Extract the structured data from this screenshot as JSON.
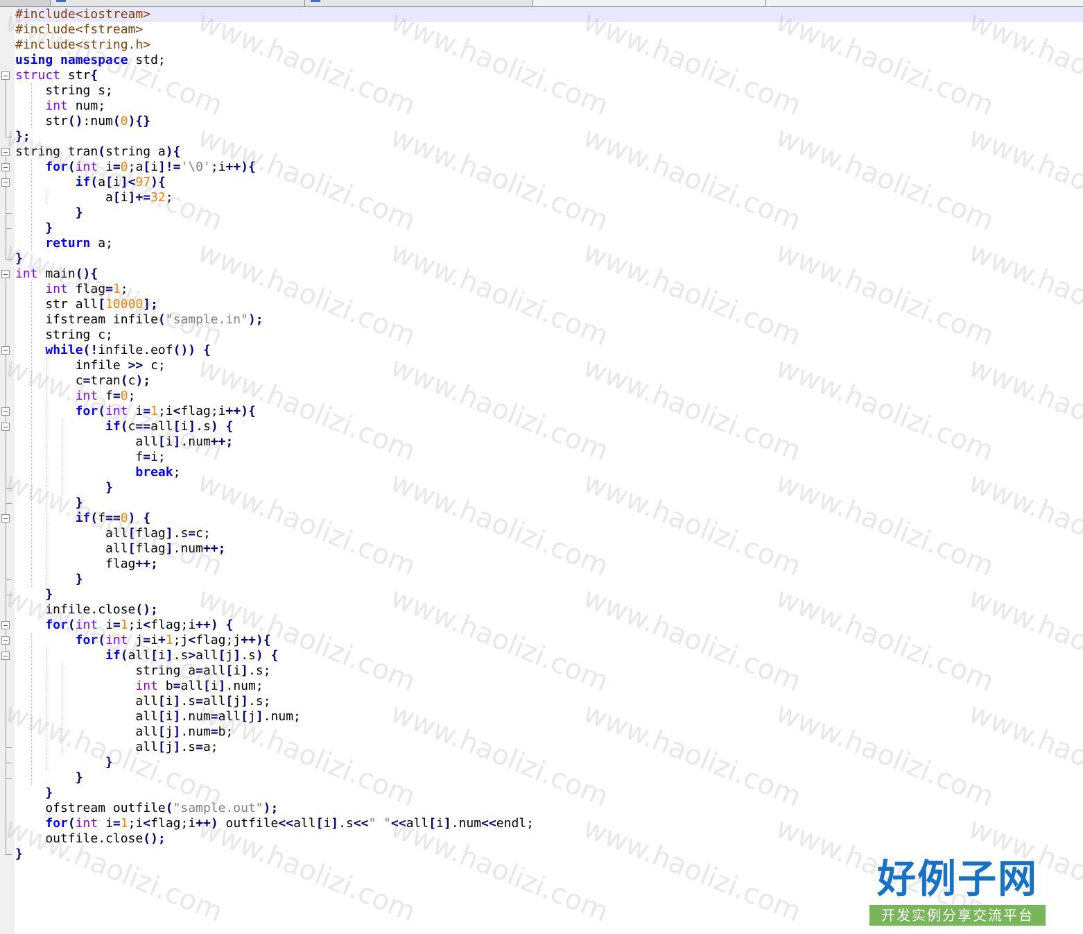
{
  "editor": {
    "lines": [
      [
        {
          "t": "#include<iostream>",
          "c": "pp"
        }
      ],
      [
        {
          "t": "#include<fstream>",
          "c": "pp"
        }
      ],
      [
        {
          "t": "#include<string.h>",
          "c": "pp"
        }
      ],
      [
        {
          "t": "using",
          "c": "kw"
        },
        {
          "t": " "
        },
        {
          "t": "namespace",
          "c": "kw"
        },
        {
          "t": " std;"
        }
      ],
      [
        {
          "t": "struct",
          "c": "ty"
        },
        {
          "t": " str"
        },
        {
          "t": "{",
          "c": "op"
        }
      ],
      [
        {
          "t": "    string s;"
        }
      ],
      [
        {
          "t": "    "
        },
        {
          "t": "int",
          "c": "ty"
        },
        {
          "t": " num;"
        }
      ],
      [
        {
          "t": "    str"
        },
        {
          "t": "()",
          "c": "op"
        },
        {
          "t": ":num"
        },
        {
          "t": "(",
          "c": "op"
        },
        {
          "t": "0",
          "c": "nu"
        },
        {
          "t": "){}",
          "c": "op"
        }
      ],
      [
        {
          "t": "};",
          "c": "op"
        }
      ],
      [
        {
          "t": "string tran"
        },
        {
          "t": "(",
          "c": "op"
        },
        {
          "t": "string a"
        },
        {
          "t": "){",
          "c": "op"
        }
      ],
      [
        {
          "t": "    "
        },
        {
          "t": "for",
          "c": "kw"
        },
        {
          "t": "(",
          "c": "op"
        },
        {
          "t": "int",
          "c": "ty"
        },
        {
          "t": " i"
        },
        {
          "t": "=",
          "c": "op"
        },
        {
          "t": "0",
          "c": "nu"
        },
        {
          "t": ";a"
        },
        {
          "t": "[",
          "c": "op"
        },
        {
          "t": "i"
        },
        {
          "t": "]!=",
          "c": "op"
        },
        {
          "t": "'\\0'",
          "c": "st"
        },
        {
          "t": ";i"
        },
        {
          "t": "++){",
          "c": "op"
        }
      ],
      [
        {
          "t": "        "
        },
        {
          "t": "if",
          "c": "kw"
        },
        {
          "t": "(",
          "c": "op"
        },
        {
          "t": "a"
        },
        {
          "t": "[",
          "c": "op"
        },
        {
          "t": "i"
        },
        {
          "t": "]<",
          "c": "op"
        },
        {
          "t": "97",
          "c": "nu"
        },
        {
          "t": "){",
          "c": "op"
        }
      ],
      [
        {
          "t": "            a"
        },
        {
          "t": "[",
          "c": "op"
        },
        {
          "t": "i"
        },
        {
          "t": "]+=",
          "c": "op"
        },
        {
          "t": "32",
          "c": "nu"
        },
        {
          "t": ";"
        }
      ],
      [
        {
          "t": "        "
        },
        {
          "t": "}",
          "c": "op"
        }
      ],
      [
        {
          "t": "    "
        },
        {
          "t": "}",
          "c": "op"
        }
      ],
      [
        {
          "t": "    "
        },
        {
          "t": "return",
          "c": "kw"
        },
        {
          "t": " a;"
        }
      ],
      [
        {
          "t": "}",
          "c": "op"
        }
      ],
      [
        {
          "t": "int",
          "c": "ty"
        },
        {
          "t": " main"
        },
        {
          "t": "(){",
          "c": "op"
        }
      ],
      [
        {
          "t": "    "
        },
        {
          "t": "int",
          "c": "ty"
        },
        {
          "t": " flag"
        },
        {
          "t": "=",
          "c": "op"
        },
        {
          "t": "1",
          "c": "nu"
        },
        {
          "t": ";"
        }
      ],
      [
        {
          "t": "    str all"
        },
        {
          "t": "[",
          "c": "op"
        },
        {
          "t": "10000",
          "c": "nu"
        },
        {
          "t": "];",
          "c": "op"
        }
      ],
      [
        {
          "t": "    ifstream infile"
        },
        {
          "t": "(",
          "c": "op"
        },
        {
          "t": "\"sample.in\"",
          "c": "st"
        },
        {
          "t": ");",
          "c": "op"
        }
      ],
      [
        {
          "t": "    string c;"
        }
      ],
      [
        {
          "t": "    "
        },
        {
          "t": "while",
          "c": "kw"
        },
        {
          "t": "(!",
          "c": "op"
        },
        {
          "t": "infile.eof"
        },
        {
          "t": "())",
          "c": "op"
        },
        {
          "t": " "
        },
        {
          "t": "{",
          "c": "op"
        }
      ],
      [
        {
          "t": "        infile "
        },
        {
          "t": ">>",
          "c": "op"
        },
        {
          "t": " c;"
        }
      ],
      [
        {
          "t": "        c"
        },
        {
          "t": "=",
          "c": "op"
        },
        {
          "t": "tran"
        },
        {
          "t": "(",
          "c": "op"
        },
        {
          "t": "c"
        },
        {
          "t": ");",
          "c": "op"
        }
      ],
      [
        {
          "t": "        "
        },
        {
          "t": "int",
          "c": "ty"
        },
        {
          "t": " f"
        },
        {
          "t": "=",
          "c": "op"
        },
        {
          "t": "0",
          "c": "nu"
        },
        {
          "t": ";"
        }
      ],
      [
        {
          "t": "        "
        },
        {
          "t": "for",
          "c": "kw"
        },
        {
          "t": "(",
          "c": "op"
        },
        {
          "t": "int",
          "c": "ty"
        },
        {
          "t": " i"
        },
        {
          "t": "=",
          "c": "op"
        },
        {
          "t": "1",
          "c": "nu"
        },
        {
          "t": ";i"
        },
        {
          "t": "<",
          "c": "op"
        },
        {
          "t": "flag;i"
        },
        {
          "t": "++){",
          "c": "op"
        }
      ],
      [
        {
          "t": "            "
        },
        {
          "t": "if",
          "c": "kw"
        },
        {
          "t": "(",
          "c": "op"
        },
        {
          "t": "c"
        },
        {
          "t": "==",
          "c": "op"
        },
        {
          "t": "all"
        },
        {
          "t": "[",
          "c": "op"
        },
        {
          "t": "i"
        },
        {
          "t": "]",
          "c": "op"
        },
        {
          "t": ".s"
        },
        {
          "t": ")",
          "c": "op"
        },
        {
          "t": " "
        },
        {
          "t": "{",
          "c": "op"
        }
      ],
      [
        {
          "t": "                all"
        },
        {
          "t": "[",
          "c": "op"
        },
        {
          "t": "i"
        },
        {
          "t": "]",
          "c": "op"
        },
        {
          "t": ".num"
        },
        {
          "t": "++;",
          "c": "op"
        }
      ],
      [
        {
          "t": "                f"
        },
        {
          "t": "=",
          "c": "op"
        },
        {
          "t": "i;"
        }
      ],
      [
        {
          "t": "                "
        },
        {
          "t": "break",
          "c": "kw"
        },
        {
          "t": ";"
        }
      ],
      [
        {
          "t": "            "
        },
        {
          "t": "}",
          "c": "op"
        }
      ],
      [
        {
          "t": "        "
        },
        {
          "t": "}",
          "c": "op"
        }
      ],
      [
        {
          "t": "        "
        },
        {
          "t": "if",
          "c": "kw"
        },
        {
          "t": "(",
          "c": "op"
        },
        {
          "t": "f"
        },
        {
          "t": "==",
          "c": "op"
        },
        {
          "t": "0",
          "c": "nu"
        },
        {
          "t": ")",
          "c": "op"
        },
        {
          "t": " "
        },
        {
          "t": "{",
          "c": "op"
        }
      ],
      [
        {
          "t": "            all"
        },
        {
          "t": "[",
          "c": "op"
        },
        {
          "t": "flag"
        },
        {
          "t": "]",
          "c": "op"
        },
        {
          "t": ".s"
        },
        {
          "t": "=",
          "c": "op"
        },
        {
          "t": "c;"
        }
      ],
      [
        {
          "t": "            all"
        },
        {
          "t": "[",
          "c": "op"
        },
        {
          "t": "flag"
        },
        {
          "t": "]",
          "c": "op"
        },
        {
          "t": ".num"
        },
        {
          "t": "++;",
          "c": "op"
        }
      ],
      [
        {
          "t": "            flag"
        },
        {
          "t": "++;",
          "c": "op"
        }
      ],
      [
        {
          "t": "        "
        },
        {
          "t": "}",
          "c": "op"
        }
      ],
      [
        {
          "t": "    "
        },
        {
          "t": "}",
          "c": "op"
        }
      ],
      [
        {
          "t": "    infile.close"
        },
        {
          "t": "();",
          "c": "op"
        }
      ],
      [
        {
          "t": "    "
        },
        {
          "t": "for",
          "c": "kw"
        },
        {
          "t": "(",
          "c": "op"
        },
        {
          "t": "int",
          "c": "ty"
        },
        {
          "t": " i"
        },
        {
          "t": "=",
          "c": "op"
        },
        {
          "t": "1",
          "c": "nu"
        },
        {
          "t": ";i"
        },
        {
          "t": "<",
          "c": "op"
        },
        {
          "t": "flag;i"
        },
        {
          "t": "++)",
          "c": "op"
        },
        {
          "t": " "
        },
        {
          "t": "{",
          "c": "op"
        }
      ],
      [
        {
          "t": "        "
        },
        {
          "t": "for",
          "c": "kw"
        },
        {
          "t": "(",
          "c": "op"
        },
        {
          "t": "int",
          "c": "ty"
        },
        {
          "t": " j"
        },
        {
          "t": "=",
          "c": "op"
        },
        {
          "t": "i"
        },
        {
          "t": "+",
          "c": "op"
        },
        {
          "t": "1",
          "c": "nu"
        },
        {
          "t": ";j"
        },
        {
          "t": "<",
          "c": "op"
        },
        {
          "t": "flag;j"
        },
        {
          "t": "++){",
          "c": "op"
        }
      ],
      [
        {
          "t": "            "
        },
        {
          "t": "if",
          "c": "kw"
        },
        {
          "t": "(",
          "c": "op"
        },
        {
          "t": "all"
        },
        {
          "t": "[",
          "c": "op"
        },
        {
          "t": "i"
        },
        {
          "t": "]",
          "c": "op"
        },
        {
          "t": ".s"
        },
        {
          "t": ">",
          "c": "op"
        },
        {
          "t": "all"
        },
        {
          "t": "[",
          "c": "op"
        },
        {
          "t": "j"
        },
        {
          "t": "]",
          "c": "op"
        },
        {
          "t": ".s"
        },
        {
          "t": ")",
          "c": "op"
        },
        {
          "t": " "
        },
        {
          "t": "{",
          "c": "op"
        }
      ],
      [
        {
          "t": "                string a"
        },
        {
          "t": "=",
          "c": "op"
        },
        {
          "t": "all"
        },
        {
          "t": "[",
          "c": "op"
        },
        {
          "t": "i"
        },
        {
          "t": "]",
          "c": "op"
        },
        {
          "t": ".s;"
        }
      ],
      [
        {
          "t": "                "
        },
        {
          "t": "int",
          "c": "ty"
        },
        {
          "t": " b"
        },
        {
          "t": "=",
          "c": "op"
        },
        {
          "t": "all"
        },
        {
          "t": "[",
          "c": "op"
        },
        {
          "t": "i"
        },
        {
          "t": "]",
          "c": "op"
        },
        {
          "t": ".num;"
        }
      ],
      [
        {
          "t": "                all"
        },
        {
          "t": "[",
          "c": "op"
        },
        {
          "t": "i"
        },
        {
          "t": "]",
          "c": "op"
        },
        {
          "t": ".s"
        },
        {
          "t": "=",
          "c": "op"
        },
        {
          "t": "all"
        },
        {
          "t": "[",
          "c": "op"
        },
        {
          "t": "j"
        },
        {
          "t": "]",
          "c": "op"
        },
        {
          "t": ".s;"
        }
      ],
      [
        {
          "t": "                all"
        },
        {
          "t": "[",
          "c": "op"
        },
        {
          "t": "i"
        },
        {
          "t": "]",
          "c": "op"
        },
        {
          "t": ".num"
        },
        {
          "t": "=",
          "c": "op"
        },
        {
          "t": "all"
        },
        {
          "t": "[",
          "c": "op"
        },
        {
          "t": "j"
        },
        {
          "t": "]",
          "c": "op"
        },
        {
          "t": ".num;"
        }
      ],
      [
        {
          "t": "                all"
        },
        {
          "t": "[",
          "c": "op"
        },
        {
          "t": "j"
        },
        {
          "t": "]",
          "c": "op"
        },
        {
          "t": ".num"
        },
        {
          "t": "=",
          "c": "op"
        },
        {
          "t": "b;"
        }
      ],
      [
        {
          "t": "                all"
        },
        {
          "t": "[",
          "c": "op"
        },
        {
          "t": "j"
        },
        {
          "t": "]",
          "c": "op"
        },
        {
          "t": ".s"
        },
        {
          "t": "=",
          "c": "op"
        },
        {
          "t": "a;"
        }
      ],
      [
        {
          "t": "            "
        },
        {
          "t": "}",
          "c": "op"
        }
      ],
      [
        {
          "t": "        "
        },
        {
          "t": "}",
          "c": "op"
        }
      ],
      [
        {
          "t": "    "
        },
        {
          "t": "}",
          "c": "op"
        }
      ],
      [
        {
          "t": "    ofstream outfile"
        },
        {
          "t": "(",
          "c": "op"
        },
        {
          "t": "\"sample.out\"",
          "c": "st"
        },
        {
          "t": ");",
          "c": "op"
        }
      ],
      [
        {
          "t": "    "
        },
        {
          "t": "for",
          "c": "kw"
        },
        {
          "t": "(",
          "c": "op"
        },
        {
          "t": "int",
          "c": "ty"
        },
        {
          "t": " i"
        },
        {
          "t": "=",
          "c": "op"
        },
        {
          "t": "1",
          "c": "nu"
        },
        {
          "t": ";i"
        },
        {
          "t": "<",
          "c": "op"
        },
        {
          "t": "flag;i"
        },
        {
          "t": "++)",
          "c": "op"
        },
        {
          "t": " outfile"
        },
        {
          "t": "<<",
          "c": "op"
        },
        {
          "t": "all"
        },
        {
          "t": "[",
          "c": "op"
        },
        {
          "t": "i"
        },
        {
          "t": "]",
          "c": "op"
        },
        {
          "t": ".s"
        },
        {
          "t": "<<",
          "c": "op"
        },
        {
          "t": "\" \"",
          "c": "st"
        },
        {
          "t": "<<",
          "c": "op"
        },
        {
          "t": "all"
        },
        {
          "t": "[",
          "c": "op"
        },
        {
          "t": "i"
        },
        {
          "t": "]",
          "c": "op"
        },
        {
          "t": ".num"
        },
        {
          "t": "<<",
          "c": "op"
        },
        {
          "t": "endl;"
        }
      ],
      [
        {
          "t": "    outfile.close"
        },
        {
          "t": "();",
          "c": "op"
        }
      ],
      [
        {
          "t": "}",
          "c": "op"
        }
      ]
    ]
  },
  "watermark": {
    "text": "www.haolizi.com"
  },
  "logo": {
    "title": "好例子网",
    "subtitle": "开发实例分享交流平台"
  },
  "colors": {
    "preprocessor": "#804000",
    "keyword": "#0000ff",
    "type": "#8000ff",
    "number": "#ff8000",
    "string": "#808080",
    "operator": "#000080",
    "current_line": "#e8e8ff",
    "logo_blue": "#1572c9",
    "logo_green": "#79b65a"
  }
}
